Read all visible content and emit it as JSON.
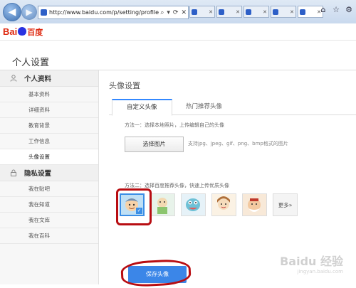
{
  "browser": {
    "url": "http://www.baidu.com/p/setting/profile/portra",
    "address_symbols": [
      "⌕",
      "▾",
      "⟳",
      "✕"
    ],
    "tabs": [
      {
        "label": ""
      },
      {
        "label": ""
      },
      {
        "label": ""
      },
      {
        "label": ""
      },
      {
        "label": ""
      }
    ],
    "window_icons": [
      "⌂",
      "☆",
      "⚙"
    ]
  },
  "header": {
    "logo_bai": "Bai",
    "logo_du": "du",
    "logo_cn": "百度"
  },
  "page": {
    "title": "个人设置"
  },
  "sidebar": {
    "section1": {
      "label": "个人资料",
      "icon": "user-icon"
    },
    "section1_items": [
      "基本资料",
      "详细资料",
      "教育背景",
      "工作信息",
      "头像设置"
    ],
    "section2": {
      "label": "隐私设置",
      "icon": "lock-icon"
    },
    "section2_items": [
      "我在贴吧",
      "我在知道",
      "我在文库",
      "我在百科"
    ],
    "active_item": "头像设置"
  },
  "main": {
    "title": "头像设置",
    "tabs": [
      "自定义头像",
      "热门推荐头像"
    ],
    "method1": "方法一：选择本地照片，上传编辑自己的头像",
    "choose_button": "选择图片",
    "support_text": "支持jpg、jpeg、gif、png、bmp格式的图片",
    "method2": "方法二：选择百度推荐头像，快速上传优质头像",
    "more_button": "更多»",
    "save_button": "保存头像"
  },
  "watermark": {
    "line1": "Baidu 经验",
    "line2": "jingyan.baidu.com"
  },
  "colors": {
    "accent": "#3b86e8",
    "annotation_red": "#b80d12",
    "baidu_red": "#de2910",
    "baidu_blue": "#2932e1"
  }
}
